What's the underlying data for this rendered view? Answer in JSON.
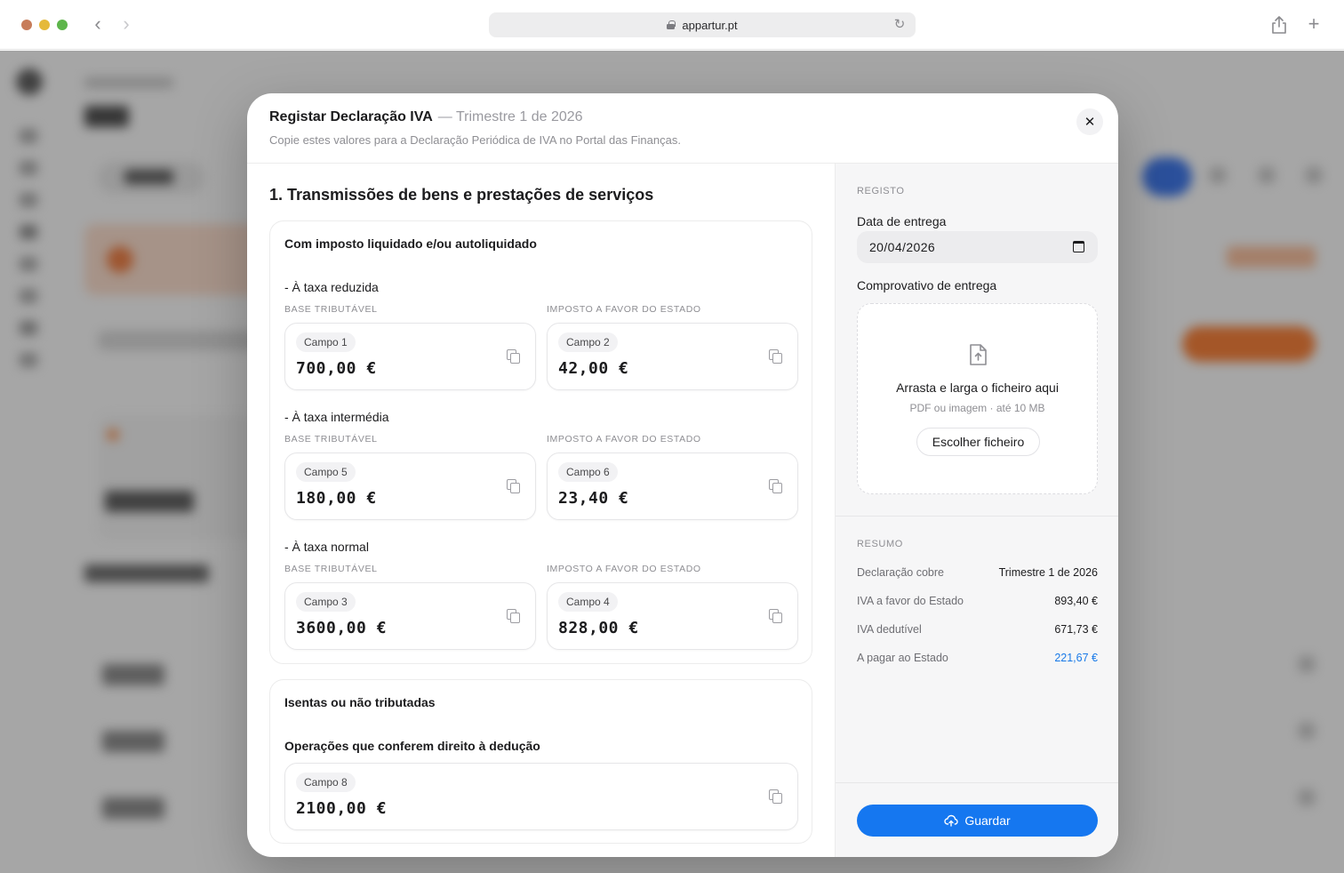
{
  "browser": {
    "url": "appartur.pt"
  },
  "modal": {
    "title": "Registar Declaração IVA",
    "period": "— Trimestre 1 de 2026",
    "subtitle": "Copie estes valores para a Declaração Periódica de IVA no Portal das Finanças.",
    "close_icon": "close-icon"
  },
  "section1": {
    "title": "1. Transmissões de bens e prestações de serviços",
    "card1_heading": "Com imposto liquidado e/ou autoliquidado",
    "col_base": "BASE TRIBUTÁVEL",
    "col_imposto": "IMPOSTO A FAVOR DO ESTADO",
    "groups": [
      {
        "label": "- À taxa reduzida",
        "base": {
          "campo": "Campo 1",
          "value": "700,00 €"
        },
        "imposto": {
          "campo": "Campo 2",
          "value": "42,00 €"
        }
      },
      {
        "label": "- À taxa intermédia",
        "base": {
          "campo": "Campo 5",
          "value": "180,00 €"
        },
        "imposto": {
          "campo": "Campo 6",
          "value": "23,40 €"
        }
      },
      {
        "label": "- À taxa normal",
        "base": {
          "campo": "Campo 3",
          "value": "3600,00 €"
        },
        "imposto": {
          "campo": "Campo 4",
          "value": "828,00 €"
        }
      }
    ],
    "card2_heading": "Isentas ou não tributadas",
    "card2_sub": "Operações que conferem direito à dedução",
    "card2_field": {
      "campo": "Campo 8",
      "value": "2100,00 €"
    }
  },
  "registo": {
    "label": "REGISTO",
    "date_label": "Data de entrega",
    "date_value": "20/04/2026",
    "proof_label": "Comprovativo de entrega",
    "dropzone_title": "Arrasta e larga o ficheiro aqui",
    "dropzone_sub": "PDF ou imagem · até 10 MB",
    "choose_button": "Escolher ficheiro"
  },
  "resumo": {
    "label": "RESUMO",
    "rows": [
      {
        "key": "Declaração cobre",
        "value": "Trimestre 1 de 2026"
      },
      {
        "key": "IVA a favor do Estado",
        "value": "893,40 €"
      },
      {
        "key": "IVA dedutível",
        "value": "671,73 €"
      },
      {
        "key": "A pagar ao Estado",
        "value": "221,67 €"
      }
    ]
  },
  "save_button": "Guardar",
  "colors": {
    "accent": "#1577f0",
    "pay_value": "#1a7ae8"
  }
}
